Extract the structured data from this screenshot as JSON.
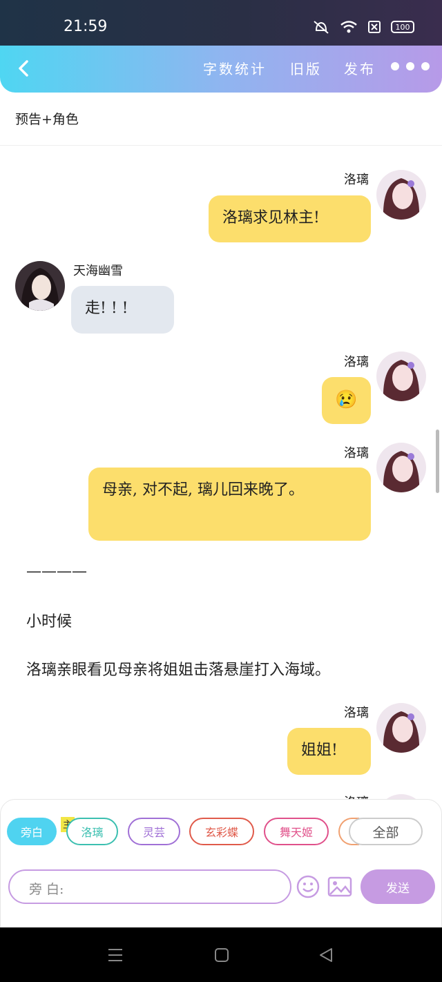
{
  "status": {
    "time": "21:59",
    "battery": "100"
  },
  "header": {
    "links": [
      "字数统计",
      "旧版",
      "发布"
    ]
  },
  "subtitle": "预告+角色",
  "messages": [
    {
      "name": "洛璃",
      "text": "洛璃求见林主!"
    },
    {
      "name": "天海幽雪",
      "text": "走! ! !"
    },
    {
      "name": "洛璃",
      "text": "😢"
    },
    {
      "name": "洛璃",
      "text": "母亲, 对不起, 璃儿回来晚了。"
    },
    {
      "name": "洛璃",
      "text": "姐姐!"
    },
    {
      "name": "洛璃"
    }
  ],
  "narration": [
    "————",
    "小时候",
    "洛璃亲眼看见母亲将姐姐击落悬崖打入海域。"
  ],
  "roles": {
    "tag": "主",
    "chips": [
      {
        "label": "旁白",
        "color": "#4fd3f0"
      },
      {
        "label": "洛璃",
        "color": "#3bbfb0"
      },
      {
        "label": "灵芸",
        "color": "#a070d6"
      },
      {
        "label": "玄彩蝶",
        "color": "#e05a4a"
      },
      {
        "label": "舞天姬",
        "color": "#e0508a"
      },
      {
        "label": "全部",
        "color": "#cccccc"
      }
    ]
  },
  "composer": {
    "placeholder": "旁 白:",
    "send_label": "发送"
  },
  "colors": {
    "bubble_self": "#fcde6c",
    "bubble_other": "#e3e8ef",
    "accent": "#c69be2"
  }
}
